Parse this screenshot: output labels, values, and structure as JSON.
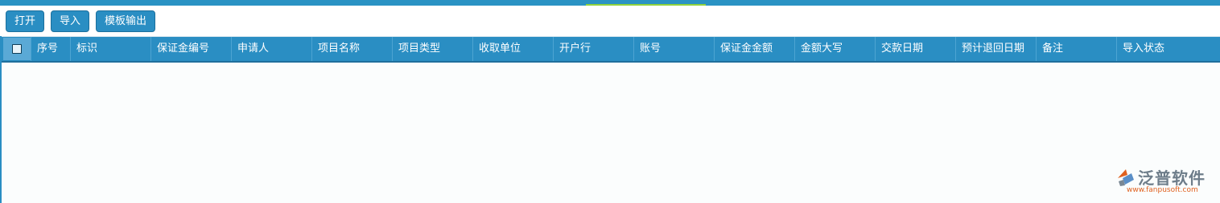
{
  "toolbar": {
    "open_label": "打开",
    "import_label": "导入",
    "export_label": "模板输出"
  },
  "grid": {
    "columns": [
      "序号",
      "标识",
      "保证金编号",
      "申请人",
      "项目名称",
      "项目类型",
      "收取单位",
      "开户行",
      "账号",
      "保证金金额",
      "金额大写",
      "交款日期",
      "预计退回日期",
      "备注",
      "导入状态"
    ]
  },
  "logo": {
    "name": "泛普软件",
    "url": "www.fanpusoft.com"
  },
  "colors": {
    "accent": "#2a8ec3",
    "header_border": "#1f6f9c",
    "highlight": "#8fd13c",
    "logo_orange": "#e0611f",
    "logo_gray": "#6e7d8a"
  }
}
